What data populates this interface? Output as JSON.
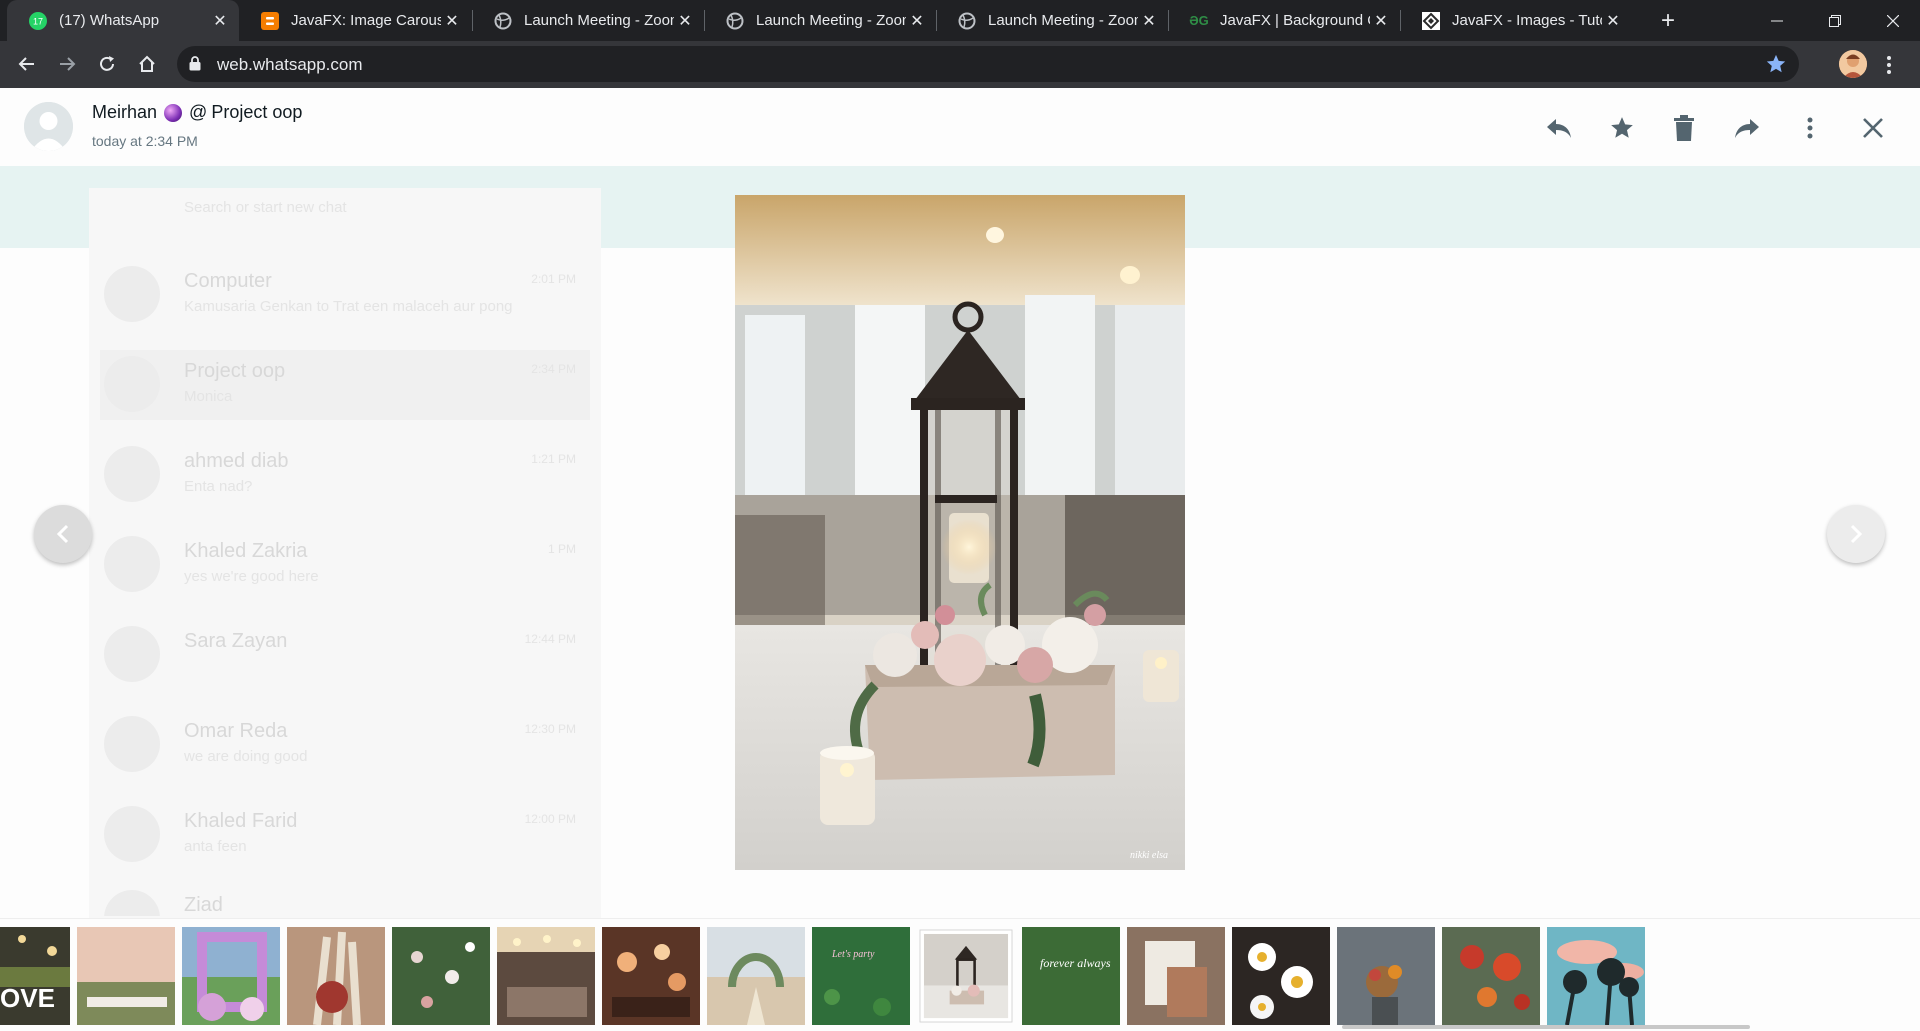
{
  "browser": {
    "tabs": [
      {
        "title": "(17) WhatsApp",
        "favicon": "whatsapp-icon",
        "active": true
      },
      {
        "title": "JavaFX: Image Carousel",
        "favicon": "blogger-icon",
        "active": false
      },
      {
        "title": "Launch Meeting - Zoom",
        "favicon": "globe-icon",
        "active": false
      },
      {
        "title": "Launch Meeting - Zoom",
        "favicon": "globe-icon",
        "active": false
      },
      {
        "title": "Launch Meeting - Zoom",
        "favicon": "globe-icon",
        "active": false
      },
      {
        "title": "JavaFX | Background Class",
        "favicon": "geeksforgeeks-icon",
        "active": false
      },
      {
        "title": "JavaFX - Images - Tutorialspoint",
        "favicon": "tutorialspoint-icon",
        "active": false
      }
    ],
    "whatsapp_badge": "17",
    "gfg_mark": "ƏG",
    "new_tab_label": "+",
    "url": "web.whatsapp.com",
    "bookmark_color": "#8ab4f8"
  },
  "viewer": {
    "sender": "Meirhan",
    "separator": "@",
    "chat_name": "Project oop",
    "timestamp": "today at 2:34 PM",
    "actions": [
      "reply-icon",
      "star-icon",
      "delete-icon",
      "forward-icon",
      "menu-icon",
      "close-icon"
    ],
    "watermark": "nikki elsa"
  },
  "background_chats": [
    {
      "name": "",
      "message": "Search or start new chat",
      "time": ""
    },
    {
      "name": "Computer",
      "message": "Kamusaria Genkan to Trat een malaceh aur pong",
      "time": "2:01 PM"
    },
    {
      "name": "Project oop",
      "message": "Monica",
      "time": "2:34 PM"
    },
    {
      "name": "ahmed diab",
      "message": "Enta nad?",
      "time": "1:21 PM"
    },
    {
      "name": "Khaled Zakria",
      "message": "yes we're good here",
      "time": "1 PM"
    },
    {
      "name": "Sara Zayan",
      "message": "",
      "time": "12:44 PM"
    },
    {
      "name": "Omar Reda",
      "message": "we are doing good",
      "time": "12:30 PM"
    },
    {
      "name": "Khaled Farid",
      "message": "anta feen",
      "time": "12:00 PM"
    },
    {
      "name": "Ziad",
      "message": "",
      "time": ""
    }
  ],
  "thumbnail_strip": {
    "count": 16,
    "selected_index": 9,
    "love_sign_text": "OVE",
    "sign_script_1": "Let's party",
    "sign_script_2": "forever always"
  },
  "colors": {
    "chrome_dark": "#202124",
    "chrome_tab": "#35363a",
    "whatsapp_green": "#25d366",
    "teal_band": "#e6f3f2"
  }
}
